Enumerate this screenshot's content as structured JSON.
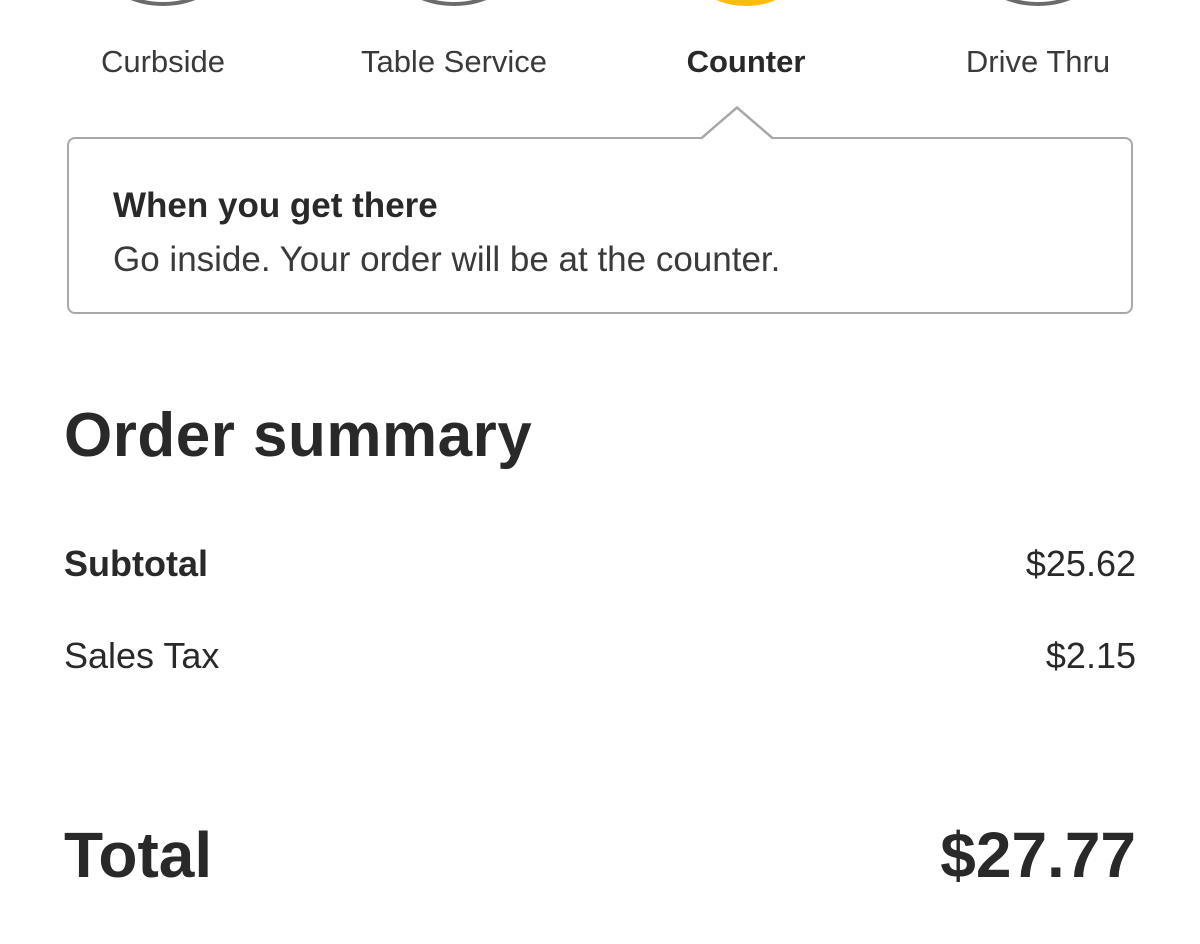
{
  "pickup_methods": {
    "items": [
      {
        "label": "Curbside",
        "selected": false
      },
      {
        "label": "Table Service",
        "selected": false
      },
      {
        "label": "Counter",
        "selected": true
      },
      {
        "label": "Drive Thru",
        "selected": false
      }
    ],
    "selected_color": "#ffbc0d"
  },
  "instructions": {
    "title": "When you get there",
    "body": "Go inside. Your order will be at the counter."
  },
  "order_summary": {
    "heading": "Order summary",
    "subtotal_label": "Subtotal",
    "subtotal_value": "$25.62",
    "tax_label": "Sales Tax",
    "tax_value": "$2.15",
    "total_label": "Total",
    "total_value": "$27.77"
  }
}
